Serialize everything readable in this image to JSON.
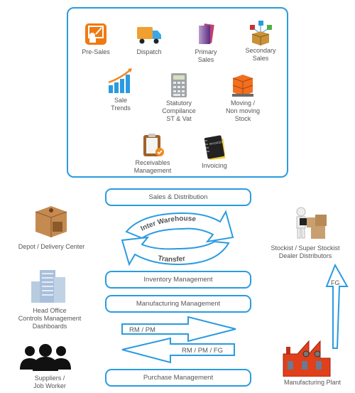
{
  "colors": {
    "accent": "#2a9be0",
    "text": "#555555"
  },
  "modules": [
    {
      "label": "Pre-Sales",
      "icon": "presales-icon"
    },
    {
      "label": "Dispatch",
      "icon": "truck-icon"
    },
    {
      "label": "Primary\nSales",
      "icon": "books-icon"
    },
    {
      "label": "Secondary\nSales",
      "icon": "box-network-icon"
    },
    {
      "label": "Sale\nTrends",
      "icon": "bar-chart-icon"
    },
    {
      "label": "Statutory\nCompilance\nST & Vat",
      "icon": "calculator-icon"
    },
    {
      "label": "Moving /\nNon moving\nStock",
      "icon": "pallet-icon"
    },
    {
      "label": "Receivables\nManagement",
      "icon": "clipboard-check-icon"
    },
    {
      "label": "Invoicing",
      "icon": "invoice-book-icon"
    }
  ],
  "flow": {
    "sales_distribution": "Sales & Distribution",
    "inter_warehouse": "Inter Warehouse",
    "transfer": "Transfer",
    "inventory_management": "Inventory Management",
    "manufacturing_management": "Manufacturing  Management",
    "rm_pm": "RM / PM",
    "rm_pm_fg": "RM / PM / FG",
    "purchase_management": "Purchase Management",
    "fg": "FG"
  },
  "entities": {
    "depot": "Depot / Delivery Center",
    "head_office": "Head Office\nControls Management\nDashboards",
    "suppliers": "Suppliers /\nJob Worker",
    "stockist": "Stockist / Super Stockist\nDealer Distributors",
    "plant": "Manufacturing Plant"
  }
}
